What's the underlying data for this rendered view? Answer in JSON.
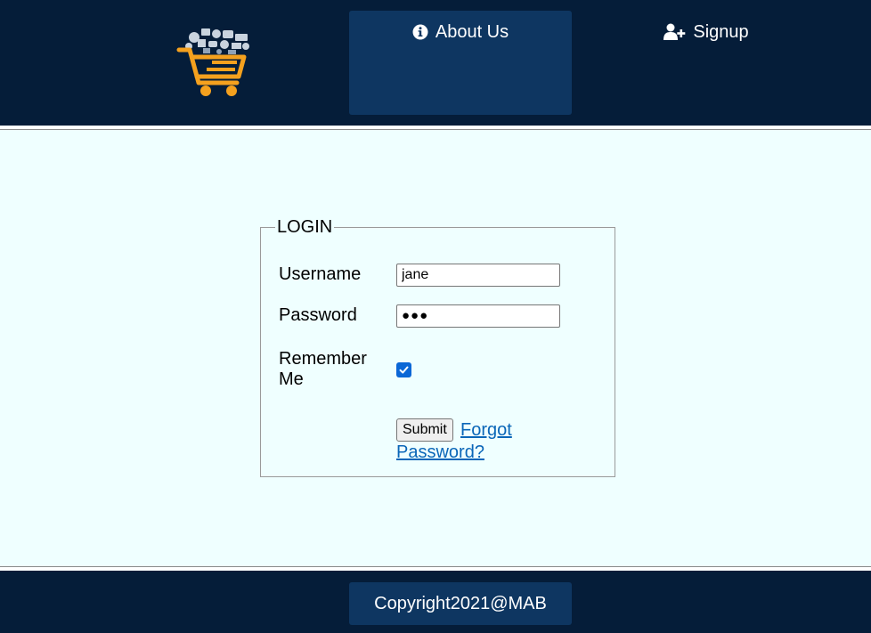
{
  "header": {
    "logo_name": "shopping-cart-logo",
    "nav": {
      "about": {
        "label": "About Us",
        "icon": "info-circle-icon"
      },
      "signup": {
        "label": "Signup",
        "icon": "user-plus-icon"
      }
    }
  },
  "login_form": {
    "legend": "LOGIN",
    "username_label": "Username",
    "username_value": "jane",
    "password_label": "Password",
    "password_value": "●●●",
    "remember_label": "Remember Me",
    "remember_checked": true,
    "submit_label": "Submit",
    "forgot_label": "Forgot Password?"
  },
  "footer": {
    "copyright": "Copyright2021@MAB"
  },
  "colors": {
    "header_bg": "#051d39",
    "nav_active_bg": "#0e3661",
    "main_bg": "#efffff",
    "link": "#0a66b8",
    "checkbox": "#0b67d6",
    "logo_cart": "#f5a11e"
  }
}
